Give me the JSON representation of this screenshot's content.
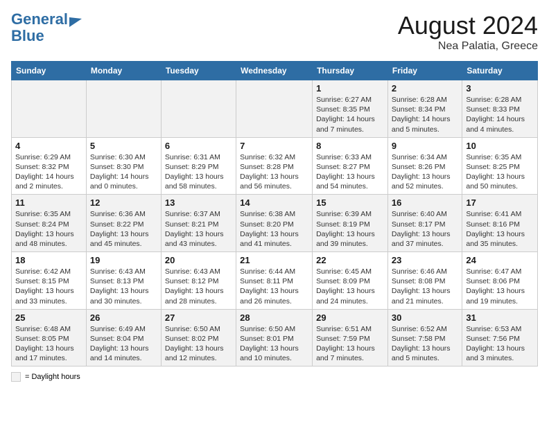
{
  "header": {
    "logo_line1": "General",
    "logo_line2": "Blue",
    "month": "August 2024",
    "location": "Nea Palatia, Greece"
  },
  "days_of_week": [
    "Sunday",
    "Monday",
    "Tuesday",
    "Wednesday",
    "Thursday",
    "Friday",
    "Saturday"
  ],
  "weeks": [
    [
      {
        "num": "",
        "info": ""
      },
      {
        "num": "",
        "info": ""
      },
      {
        "num": "",
        "info": ""
      },
      {
        "num": "",
        "info": ""
      },
      {
        "num": "1",
        "info": "Sunrise: 6:27 AM\nSunset: 8:35 PM\nDaylight: 14 hours and 7 minutes."
      },
      {
        "num": "2",
        "info": "Sunrise: 6:28 AM\nSunset: 8:34 PM\nDaylight: 14 hours and 5 minutes."
      },
      {
        "num": "3",
        "info": "Sunrise: 6:28 AM\nSunset: 8:33 PM\nDaylight: 14 hours and 4 minutes."
      }
    ],
    [
      {
        "num": "4",
        "info": "Sunrise: 6:29 AM\nSunset: 8:32 PM\nDaylight: 14 hours and 2 minutes."
      },
      {
        "num": "5",
        "info": "Sunrise: 6:30 AM\nSunset: 8:30 PM\nDaylight: 14 hours and 0 minutes."
      },
      {
        "num": "6",
        "info": "Sunrise: 6:31 AM\nSunset: 8:29 PM\nDaylight: 13 hours and 58 minutes."
      },
      {
        "num": "7",
        "info": "Sunrise: 6:32 AM\nSunset: 8:28 PM\nDaylight: 13 hours and 56 minutes."
      },
      {
        "num": "8",
        "info": "Sunrise: 6:33 AM\nSunset: 8:27 PM\nDaylight: 13 hours and 54 minutes."
      },
      {
        "num": "9",
        "info": "Sunrise: 6:34 AM\nSunset: 8:26 PM\nDaylight: 13 hours and 52 minutes."
      },
      {
        "num": "10",
        "info": "Sunrise: 6:35 AM\nSunset: 8:25 PM\nDaylight: 13 hours and 50 minutes."
      }
    ],
    [
      {
        "num": "11",
        "info": "Sunrise: 6:35 AM\nSunset: 8:24 PM\nDaylight: 13 hours and 48 minutes."
      },
      {
        "num": "12",
        "info": "Sunrise: 6:36 AM\nSunset: 8:22 PM\nDaylight: 13 hours and 45 minutes."
      },
      {
        "num": "13",
        "info": "Sunrise: 6:37 AM\nSunset: 8:21 PM\nDaylight: 13 hours and 43 minutes."
      },
      {
        "num": "14",
        "info": "Sunrise: 6:38 AM\nSunset: 8:20 PM\nDaylight: 13 hours and 41 minutes."
      },
      {
        "num": "15",
        "info": "Sunrise: 6:39 AM\nSunset: 8:19 PM\nDaylight: 13 hours and 39 minutes."
      },
      {
        "num": "16",
        "info": "Sunrise: 6:40 AM\nSunset: 8:17 PM\nDaylight: 13 hours and 37 minutes."
      },
      {
        "num": "17",
        "info": "Sunrise: 6:41 AM\nSunset: 8:16 PM\nDaylight: 13 hours and 35 minutes."
      }
    ],
    [
      {
        "num": "18",
        "info": "Sunrise: 6:42 AM\nSunset: 8:15 PM\nDaylight: 13 hours and 33 minutes."
      },
      {
        "num": "19",
        "info": "Sunrise: 6:43 AM\nSunset: 8:13 PM\nDaylight: 13 hours and 30 minutes."
      },
      {
        "num": "20",
        "info": "Sunrise: 6:43 AM\nSunset: 8:12 PM\nDaylight: 13 hours and 28 minutes."
      },
      {
        "num": "21",
        "info": "Sunrise: 6:44 AM\nSunset: 8:11 PM\nDaylight: 13 hours and 26 minutes."
      },
      {
        "num": "22",
        "info": "Sunrise: 6:45 AM\nSunset: 8:09 PM\nDaylight: 13 hours and 24 minutes."
      },
      {
        "num": "23",
        "info": "Sunrise: 6:46 AM\nSunset: 8:08 PM\nDaylight: 13 hours and 21 minutes."
      },
      {
        "num": "24",
        "info": "Sunrise: 6:47 AM\nSunset: 8:06 PM\nDaylight: 13 hours and 19 minutes."
      }
    ],
    [
      {
        "num": "25",
        "info": "Sunrise: 6:48 AM\nSunset: 8:05 PM\nDaylight: 13 hours and 17 minutes."
      },
      {
        "num": "26",
        "info": "Sunrise: 6:49 AM\nSunset: 8:04 PM\nDaylight: 13 hours and 14 minutes."
      },
      {
        "num": "27",
        "info": "Sunrise: 6:50 AM\nSunset: 8:02 PM\nDaylight: 13 hours and 12 minutes."
      },
      {
        "num": "28",
        "info": "Sunrise: 6:50 AM\nSunset: 8:01 PM\nDaylight: 13 hours and 10 minutes."
      },
      {
        "num": "29",
        "info": "Sunrise: 6:51 AM\nSunset: 7:59 PM\nDaylight: 13 hours and 7 minutes."
      },
      {
        "num": "30",
        "info": "Sunrise: 6:52 AM\nSunset: 7:58 PM\nDaylight: 13 hours and 5 minutes."
      },
      {
        "num": "31",
        "info": "Sunrise: 6:53 AM\nSunset: 7:56 PM\nDaylight: 13 hours and 3 minutes."
      }
    ]
  ],
  "legend": {
    "box_label": "= Daylight hours"
  }
}
